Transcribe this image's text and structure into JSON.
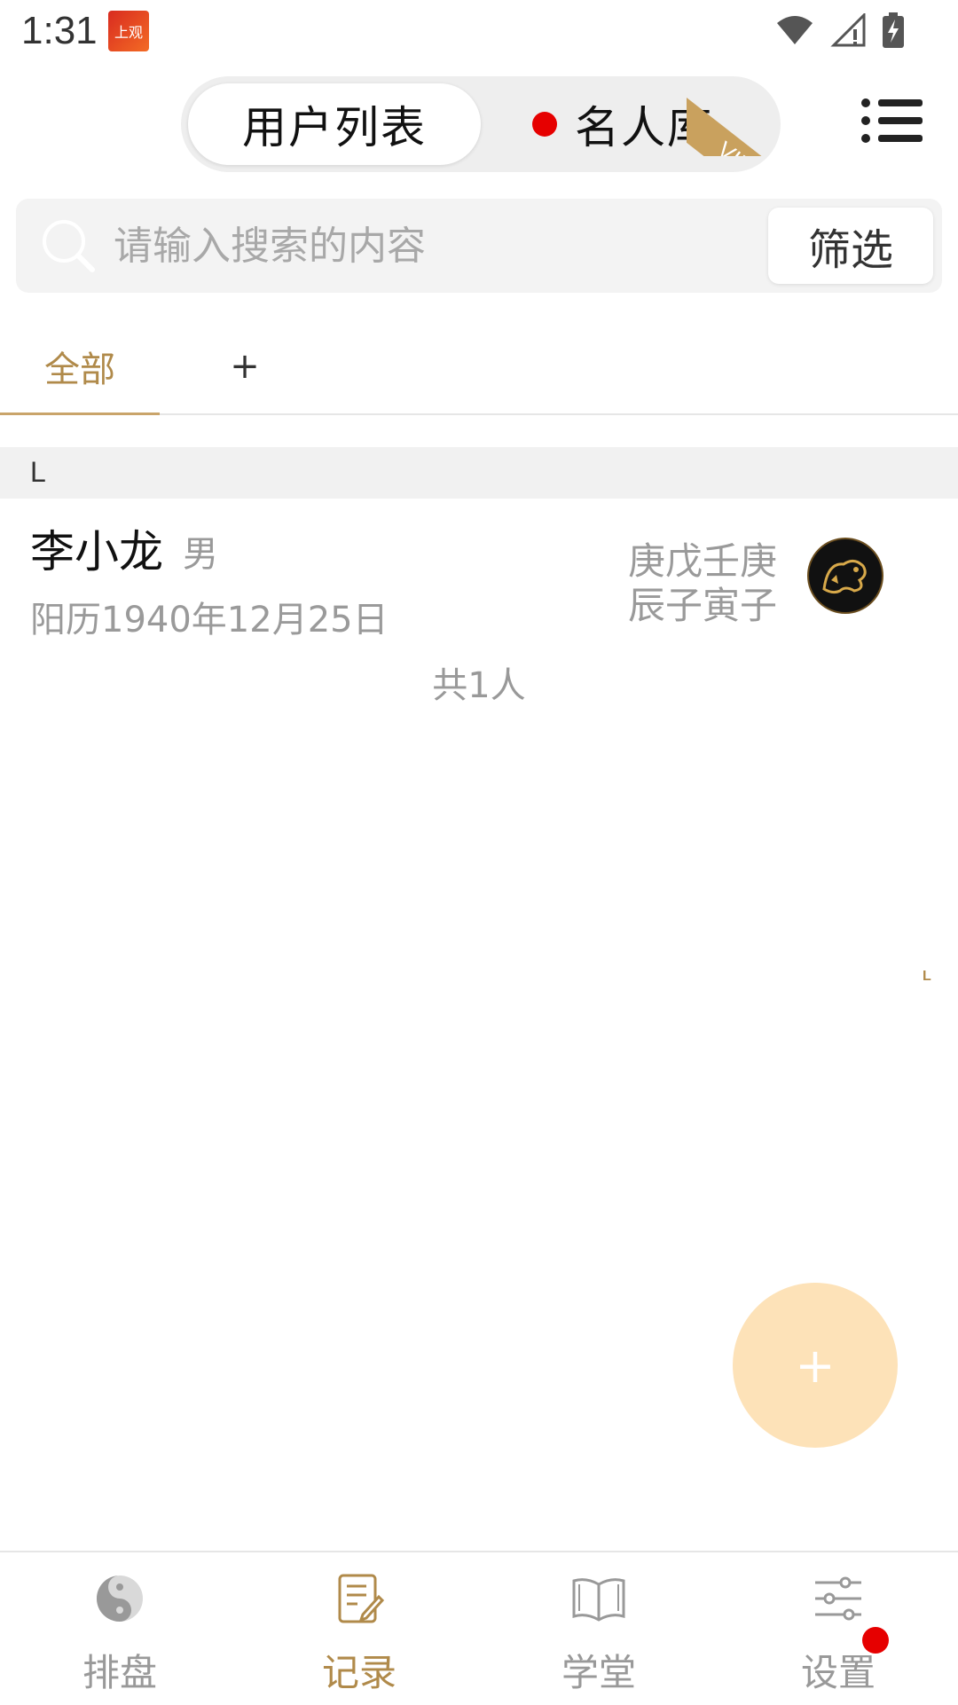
{
  "status_bar": {
    "time": "1:31",
    "app_icon_text": "上观"
  },
  "header": {
    "tab_user_list": "用户列表",
    "tab_celebrity": "名人库",
    "vip_label": "VIP"
  },
  "search": {
    "placeholder": "请输入搜索的内容",
    "filter_label": "筛选"
  },
  "tabs": {
    "all_label": "全部",
    "add_label": "+"
  },
  "list": {
    "section_letter": "L",
    "records": [
      {
        "name": "李小龙",
        "gender": "男",
        "date": "阳历1940年12月25日",
        "bazi_line1": "庚戊壬庚",
        "bazi_line2": "辰子寅子"
      }
    ],
    "total": "共1人",
    "index_letter": "L"
  },
  "fab": {
    "label": "+"
  },
  "bottom_nav": {
    "items": [
      {
        "label": "排盘",
        "icon": "yin-yang-icon",
        "active": false
      },
      {
        "label": "记录",
        "icon": "notepad-icon",
        "active": true
      },
      {
        "label": "学堂",
        "icon": "book-icon",
        "active": false
      },
      {
        "label": "设置",
        "icon": "sliders-icon",
        "active": false
      }
    ]
  },
  "colors": {
    "accent": "#b08a4a",
    "vip": "#c9a15e",
    "fab": "#fde2b8",
    "badge": "#e60000"
  }
}
